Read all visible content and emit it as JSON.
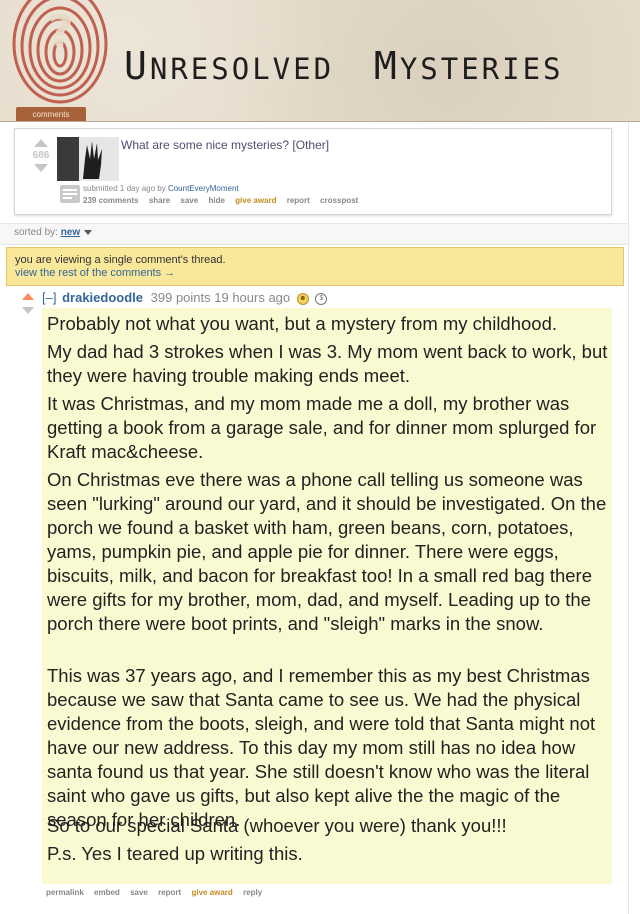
{
  "header": {
    "title_caps": [
      "U",
      "M"
    ],
    "title_rest": [
      "NRESOLVED",
      "YSTERIES"
    ],
    "tab_label": "comments"
  },
  "post": {
    "score": "686",
    "title": "What are some nice mysteries?",
    "flair": "[Other]",
    "submitted_prefix": "submitted 1 day ago by ",
    "author": "CountEveryMoment",
    "actions": [
      "239 comments",
      "share",
      "save",
      "hide",
      "give award",
      "report",
      "crosspost"
    ]
  },
  "sort": {
    "label": "sorted by: ",
    "value": "new"
  },
  "notice": {
    "line1": "you are viewing a single comment's thread.",
    "line2": "view the rest of the comments →"
  },
  "comment": {
    "expand": "[–]",
    "author": "drakiedoodle",
    "meta": "399 points 19 hours ago",
    "paragraphs": [
      "Probably not what you want, but a mystery from my childhood.",
      "My dad had 3 strokes when I was 3. My mom went back to work, but they were having trouble making ends meet.",
      "It was Christmas, and my mom made me a doll, my brother was getting a book from a garage sale, and for dinner mom splurged for Kraft mac&cheese.",
      "On Christmas eve there was a phone call telling us someone was seen \"lurking\" around our yard, and it should be investigated. On the porch we found a basket with ham, green beans, corn, potatoes, yams, pumpkin pie, and apple pie for dinner. There were eggs, biscuits, milk, and bacon for breakfast too! In a small red bag there were gifts for my brother, mom, dad, and myself. Leading up to the porch there were boot prints, and \"sleigh\" marks in the snow.",
      "This was 37 years ago, and I remember this as my best Christmas because we saw that Santa came to see us. We had the physical evidence from the boots, sleigh, and were told that Santa might not have our new address. To this day my mom still has no idea how santa found us that year. She still doesn't know who was the literal saint who gave us gifts, but also kept alive the the magic of the season for her children.",
      "So to our special Santa (whoever you were) thank you!!!",
      "P.s. Yes I teared up writing this."
    ],
    "actions": [
      "permalink",
      "embed",
      "save",
      "report",
      "give award",
      "reply"
    ]
  },
  "colors": {
    "link": "#336699",
    "award": "#c28d23",
    "comment_bg": "#fafad2",
    "notice_bg": "#f9e79a",
    "upvoted": "#ff8b60"
  },
  "icons": [
    "fingerprint-icon",
    "upvote-icon",
    "downvote-icon",
    "selftext-icon",
    "award-badge-icon",
    "caret-down-icon"
  ]
}
